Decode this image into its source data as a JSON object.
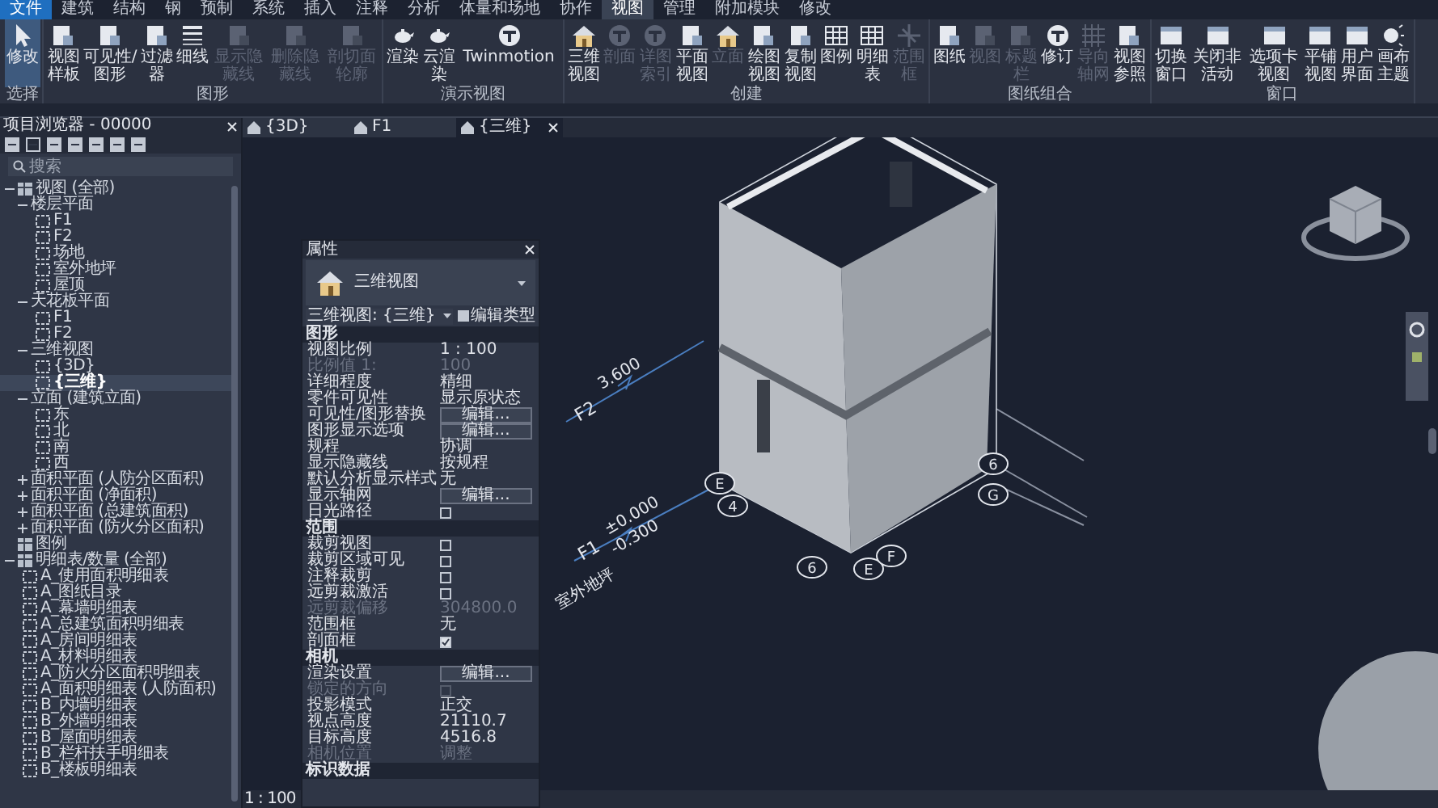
{
  "menu_tabs": [
    {
      "label": "文件",
      "kind": "app",
      "selected": false
    },
    {
      "label": "建筑",
      "kind": "tab",
      "selected": false
    },
    {
      "label": "结构",
      "kind": "tab",
      "selected": false
    },
    {
      "label": "钢",
      "kind": "tab",
      "selected": false
    },
    {
      "label": "预制",
      "kind": "tab",
      "selected": false
    },
    {
      "label": "系统",
      "kind": "tab",
      "selected": false
    },
    {
      "label": "插入",
      "kind": "tab",
      "selected": false
    },
    {
      "label": "注释",
      "kind": "tab",
      "selected": false
    },
    {
      "label": "分析",
      "kind": "tab",
      "selected": false
    },
    {
      "label": "体量和场地",
      "kind": "tab",
      "selected": false
    },
    {
      "label": "协作",
      "kind": "tab",
      "selected": false
    },
    {
      "label": "视图",
      "kind": "tab",
      "selected": true
    },
    {
      "label": "管理",
      "kind": "tab",
      "selected": false
    },
    {
      "label": "附加模块",
      "kind": "tab",
      "selected": false
    },
    {
      "label": "修改",
      "kind": "tab",
      "selected": false
    }
  ],
  "ribbon": {
    "groups": [
      {
        "label": "选择",
        "buttons": [
          {
            "label": "修改",
            "selected": true
          }
        ]
      },
      {
        "label": "图形",
        "buttons": [
          {
            "label": "视图样板"
          },
          {
            "label": "可见性/图形"
          },
          {
            "label": "过滤器"
          },
          {
            "label": "细线"
          },
          {
            "label": "显示隐藏线",
            "disabled": true
          },
          {
            "label": "删除隐藏线",
            "disabled": true
          },
          {
            "label": "剖切面轮廓",
            "disabled": true
          }
        ]
      },
      {
        "label": "演示视图",
        "buttons": [
          {
            "label": "渲染"
          },
          {
            "label": "云渲染"
          },
          {
            "label": "Twinmotion"
          }
        ]
      },
      {
        "label": "创建",
        "buttons": [
          {
            "label": "三维视图"
          },
          {
            "label": "剖面",
            "disabled": true
          },
          {
            "label": "详图索引",
            "disabled": true
          },
          {
            "label": "平面视图"
          },
          {
            "label": "立面",
            "disabled": true
          },
          {
            "label": "绘图视图"
          },
          {
            "label": "复制视图"
          },
          {
            "label": "图例"
          },
          {
            "label": "明细表"
          },
          {
            "label": "范围框",
            "disabled": true
          }
        ]
      },
      {
        "label": "图纸组合",
        "buttons": [
          {
            "label": "图纸"
          },
          {
            "label": "视图",
            "disabled": true
          },
          {
            "label": "标题栏",
            "disabled": true
          },
          {
            "label": "修订"
          },
          {
            "label": "导向轴网",
            "disabled": true
          },
          {
            "label": "视图参照"
          }
        ]
      },
      {
        "label": "窗口",
        "buttons": [
          {
            "label": "切换窗口"
          },
          {
            "label": "关闭非活动"
          },
          {
            "label": "选项卡视图"
          },
          {
            "label": "平铺视图"
          },
          {
            "label": "用户界面"
          },
          {
            "label": "画布主题"
          }
        ]
      }
    ]
  },
  "project_browser": {
    "title": "项目浏览器 - 00000",
    "search": {
      "placeholder": "搜索"
    },
    "tree": [
      {
        "label": "视图 (全部)",
        "kind": "root",
        "expanded": true,
        "children": [
          {
            "label": "楼层平面",
            "kind": "folder",
            "expanded": true,
            "children": [
              {
                "label": "F1",
                "kind": "view",
                "selected": false
              },
              {
                "label": "F2",
                "kind": "view",
                "selected": false
              },
              {
                "label": "场地",
                "kind": "view",
                "selected": false
              },
              {
                "label": "室外地坪",
                "kind": "view",
                "selected": false
              },
              {
                "label": "屋顶",
                "kind": "view",
                "selected": false
              }
            ]
          },
          {
            "label": "天花板平面",
            "kind": "folder",
            "expanded": true,
            "children": [
              {
                "label": "F1",
                "kind": "view",
                "selected": false
              },
              {
                "label": "F2",
                "kind": "view",
                "selected": false
              }
            ]
          },
          {
            "label": "三维视图",
            "kind": "folder",
            "expanded": true,
            "children": [
              {
                "label": "{3D}",
                "kind": "view",
                "selected": false
              },
              {
                "label": "{三维}",
                "kind": "view",
                "selected": true
              }
            ]
          },
          {
            "label": "立面 (建筑立面)",
            "kind": "folder",
            "expanded": true,
            "children": [
              {
                "label": "东",
                "kind": "view",
                "selected": false
              },
              {
                "label": "北",
                "kind": "view",
                "selected": false
              },
              {
                "label": "南",
                "kind": "view",
                "selected": false
              },
              {
                "label": "西",
                "kind": "view",
                "selected": false
              }
            ]
          },
          {
            "label": "面积平面 (人防分区面积)",
            "kind": "folder",
            "expanded": false
          },
          {
            "label": "面积平面 (净面积)",
            "kind": "folder",
            "expanded": false
          },
          {
            "label": "面积平面 (总建筑面积)",
            "kind": "folder",
            "expanded": false
          },
          {
            "label": "面积平面 (防火分区面积)",
            "kind": "folder",
            "expanded": false
          }
        ]
      },
      {
        "label": "图例",
        "kind": "root"
      },
      {
        "label": "明细表/数量 (全部)",
        "kind": "root",
        "expanded": true,
        "children": [
          {
            "label": "A_使用面积明细表",
            "kind": "view",
            "selected": false
          },
          {
            "label": "A_图纸目录",
            "kind": "view",
            "selected": false
          },
          {
            "label": "A_幕墙明细表",
            "kind": "view",
            "selected": false
          },
          {
            "label": "A_总建筑面积明细表",
            "kind": "view",
            "selected": false
          },
          {
            "label": "A_房间明细表",
            "kind": "view",
            "selected": false
          },
          {
            "label": "A_材料明细表",
            "kind": "view",
            "selected": false
          },
          {
            "label": "A_防火分区面积明细表",
            "kind": "view",
            "selected": false
          },
          {
            "label": "A_面积明细表 (人防面积)",
            "kind": "view",
            "selected": false
          },
          {
            "label": "B_内墙明细表",
            "kind": "view",
            "selected": false
          },
          {
            "label": "B_外墙明细表",
            "kind": "view",
            "selected": false
          },
          {
            "label": "B_屋面明细表",
            "kind": "view",
            "selected": false
          },
          {
            "label": "B_栏杆扶手明细表",
            "kind": "view",
            "selected": false
          },
          {
            "label": "B_楼板明细表",
            "kind": "view",
            "selected": false
          }
        ]
      }
    ]
  },
  "view_tabs": [
    {
      "label": "{3D}",
      "selected": false
    },
    {
      "label": "F1",
      "selected": false
    },
    {
      "label": "{三维}",
      "selected": true
    }
  ],
  "properties": {
    "title": "属性",
    "type_name": "三维视图",
    "instance": "三维视图: {三维}",
    "edit_type": "编辑类型",
    "sections": [
      {
        "title": "图形",
        "rows": [
          {
            "label": "视图比例",
            "kind": "text",
            "value": "1 : 100"
          },
          {
            "label": "比例值 1:",
            "kind": "text",
            "value": "100",
            "disabled": true
          },
          {
            "label": "详细程度",
            "kind": "text",
            "value": "精细"
          },
          {
            "label": "零件可见性",
            "kind": "text",
            "value": "显示原状态"
          },
          {
            "label": "可见性/图形替换",
            "kind": "button",
            "value": "编辑..."
          },
          {
            "label": "图形显示选项",
            "kind": "button",
            "value": "编辑..."
          },
          {
            "label": "规程",
            "kind": "text",
            "value": "协调"
          },
          {
            "label": "显示隐藏线",
            "kind": "text",
            "value": "按规程"
          },
          {
            "label": "默认分析显示样式",
            "kind": "text",
            "value": "无"
          },
          {
            "label": "显示轴网",
            "kind": "button",
            "value": "编辑..."
          },
          {
            "label": "日光路径",
            "kind": "checkbox",
            "checked": false
          }
        ]
      },
      {
        "title": "范围",
        "rows": [
          {
            "label": "裁剪视图",
            "kind": "checkbox",
            "checked": false
          },
          {
            "label": "裁剪区域可见",
            "kind": "checkbox",
            "checked": false
          },
          {
            "label": "注释裁剪",
            "kind": "checkbox",
            "checked": false
          },
          {
            "label": "远剪裁激活",
            "kind": "checkbox",
            "checked": false
          },
          {
            "label": "远剪裁偏移",
            "kind": "text",
            "value": "304800.0",
            "disabled": true
          },
          {
            "label": "范围框",
            "kind": "text",
            "value": "无"
          },
          {
            "label": "剖面框",
            "kind": "checkbox",
            "checked": true
          }
        ]
      },
      {
        "title": "相机",
        "rows": [
          {
            "label": "渲染设置",
            "kind": "button",
            "value": "编辑..."
          },
          {
            "label": "锁定的方向",
            "kind": "checkbox",
            "checked": false,
            "disabled": true
          },
          {
            "label": "投影模式",
            "kind": "text",
            "value": "正交"
          },
          {
            "label": "视点高度",
            "kind": "text",
            "value": "21110.7"
          },
          {
            "label": "目标高度",
            "kind": "text",
            "value": "4516.8"
          },
          {
            "label": "相机位置",
            "kind": "text",
            "value": "调整",
            "disabled": true
          }
        ]
      },
      {
        "title": "标识数据"
      }
    ]
  },
  "view": {
    "levels": [
      {
        "name": "F2",
        "elevation": "3.600"
      },
      {
        "name": "F1",
        "elevation": "±0.000"
      },
      {
        "name": "室外地坪",
        "elevation": "-0.300"
      }
    ],
    "grid_bubbles": [
      "E",
      "4",
      "6",
      "E",
      "F",
      "6",
      "G"
    ],
    "scale": "1 : 100"
  }
}
